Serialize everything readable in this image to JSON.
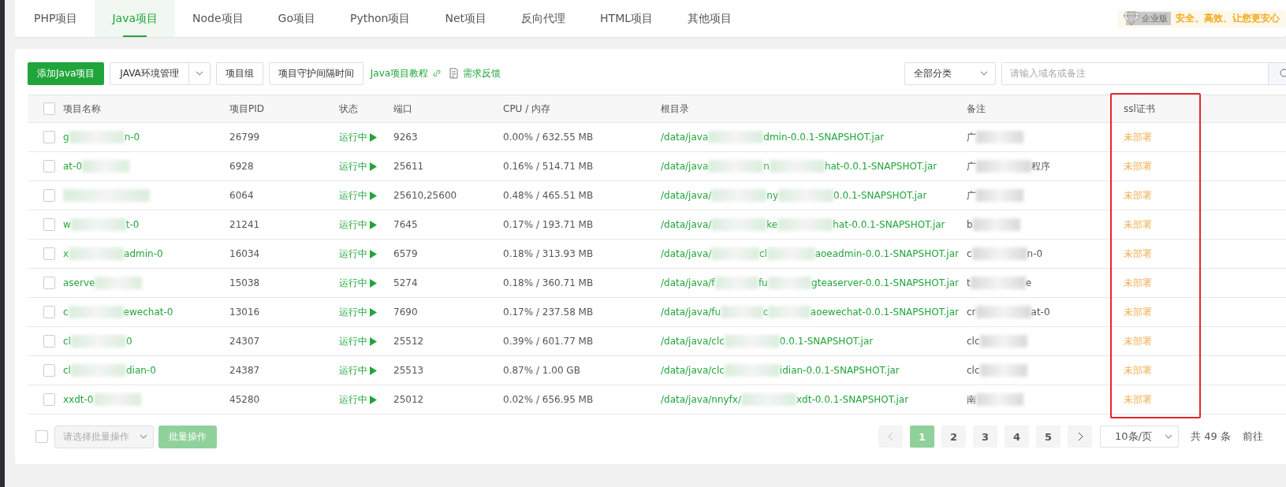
{
  "tabs": [
    {
      "label": "PHP项目",
      "selected": false
    },
    {
      "label": "Java项目",
      "selected": true
    },
    {
      "label": "Node项目",
      "selected": false
    },
    {
      "label": "Go项目",
      "selected": false
    },
    {
      "label": "Python项目",
      "selected": false
    },
    {
      "label": "Net项目",
      "selected": false
    },
    {
      "label": "反向代理",
      "selected": false
    },
    {
      "label": "HTML项目",
      "selected": false
    },
    {
      "label": "其他项目",
      "selected": false
    }
  ],
  "edition": {
    "badge": "企业版",
    "slogan": "安全、高效、让您更安心"
  },
  "toolbar": {
    "add_button": "添加Java项目",
    "env_button": "JAVA环境管理",
    "group_button": "项目组",
    "guard_button": "项目守护间隔时间",
    "tutorial_link": "Java项目教程",
    "feedback_link": "需求反馈",
    "category": "全部分类",
    "search": {
      "placeholder": "请输入域名或备注"
    }
  },
  "table": {
    "select_all_checked": false,
    "columns": [
      "项目名称",
      "项目PID",
      "状态",
      "端口",
      "CPU / 内存",
      "根目录",
      "备注",
      "ssl证书"
    ],
    "rows": [
      {
        "checked": false,
        "name": [
          "g",
          "n-0"
        ],
        "pid": "26799",
        "status": "运行中",
        "port": "9263",
        "cpu_mem": "0.00% / 632.55 MB",
        "root": [
          "/data/java",
          "dmin-0.0.1-SNAPSHOT.jar"
        ],
        "note": [
          "广"
        ],
        "ssl": "未部署"
      },
      {
        "checked": false,
        "name": [
          "at-0"
        ],
        "pid": "6928",
        "status": "运行中",
        "port": "25611",
        "cpu_mem": "0.16% / 514.71 MB",
        "root": [
          "/data/java",
          "n",
          "hat-0.0.1-SNAPSHOT.jar"
        ],
        "note": [
          "广",
          "程序"
        ],
        "ssl": "未部署"
      },
      {
        "checked": false,
        "pid": "6064",
        "status": "运行中",
        "port": "25610,25600",
        "cpu_mem": "0.48% / 465.51 MB",
        "root": [
          "/data/java/",
          "ny",
          "0.0.1-SNAPSHOT.jar"
        ],
        "note": [
          "广"
        ],
        "ssl": "未部署"
      },
      {
        "checked": false,
        "name": [
          "w",
          "t-0"
        ],
        "pid": "21241",
        "status": "运行中",
        "port": "7645",
        "cpu_mem": "0.17% / 193.71 MB",
        "root": [
          "/data/java/",
          "ke",
          "hat-0.0.1-SNAPSHOT.jar"
        ],
        "note": [
          "b"
        ],
        "ssl": "未部署"
      },
      {
        "checked": false,
        "name": [
          "x",
          "admin-0"
        ],
        "pid": "16034",
        "status": "运行中",
        "port": "6579",
        "cpu_mem": "0.18% / 313.93 MB",
        "root": [
          "/data/java/",
          "cl",
          "aoeadmin-0.0.1-SNAPSHOT.jar"
        ],
        "note": [
          "c",
          "n-0"
        ],
        "ssl": "未部署"
      },
      {
        "checked": false,
        "name": [
          "aserve"
        ],
        "pid": "15038",
        "status": "运行中",
        "port": "5274",
        "cpu_mem": "0.18% / 360.71 MB",
        "root": [
          "/data/java/f",
          "fu",
          "gteaserver-0.0.1-SNAPSHOT.jar"
        ],
        "note": [
          "t",
          "e"
        ],
        "ssl": "未部署"
      },
      {
        "checked": false,
        "name": [
          "c",
          "ewechat-0"
        ],
        "pid": "13016",
        "status": "运行中",
        "port": "7690",
        "cpu_mem": "0.17% / 237.58 MB",
        "root": [
          "/data/java/fu",
          "c",
          "aoewechat-0.0.1-SNAPSHOT.jar"
        ],
        "note": [
          "cr",
          "at-0"
        ],
        "ssl": "未部署"
      },
      {
        "checked": false,
        "name": [
          "cl",
          "0"
        ],
        "pid": "24307",
        "status": "运行中",
        "port": "25512",
        "cpu_mem": "0.39% / 601.77 MB",
        "root": [
          "/data/java/clc",
          "0.0.1-SNAPSHOT.jar"
        ],
        "note": [
          "clc"
        ],
        "ssl": "未部署"
      },
      {
        "checked": false,
        "name": [
          "cl",
          "dian-0"
        ],
        "pid": "24387",
        "status": "运行中",
        "port": "25513",
        "cpu_mem": "0.87% / 1.00 GB",
        "root": [
          "/data/java/clc",
          "idian-0.0.1-SNAPSHOT.jar"
        ],
        "note": [
          "clc"
        ],
        "ssl": "未部署"
      },
      {
        "checked": false,
        "name": [
          "xxdt-0"
        ],
        "pid": "45280",
        "status": "运行中",
        "port": "25012",
        "cpu_mem": "0.02% / 656.95 MB",
        "root": [
          "/data/java/nnyfx/",
          "xdt-0.0.1-SNAPSHOT.jar"
        ],
        "note": [
          "南"
        ],
        "ssl": "未部署"
      }
    ]
  },
  "footer": {
    "select_all_checked": false,
    "batch_select": {
      "placeholder": "请选择批量操作"
    },
    "batch_button": "批量操作",
    "pages": [
      {
        "label": "1",
        "selected": true
      },
      {
        "label": "2",
        "selected": false
      },
      {
        "label": "3",
        "selected": false
      },
      {
        "label": "4",
        "selected": false
      },
      {
        "label": "5",
        "selected": false
      }
    ],
    "page_size": "10条/页",
    "total": "共 49 条",
    "goto": "前往"
  }
}
